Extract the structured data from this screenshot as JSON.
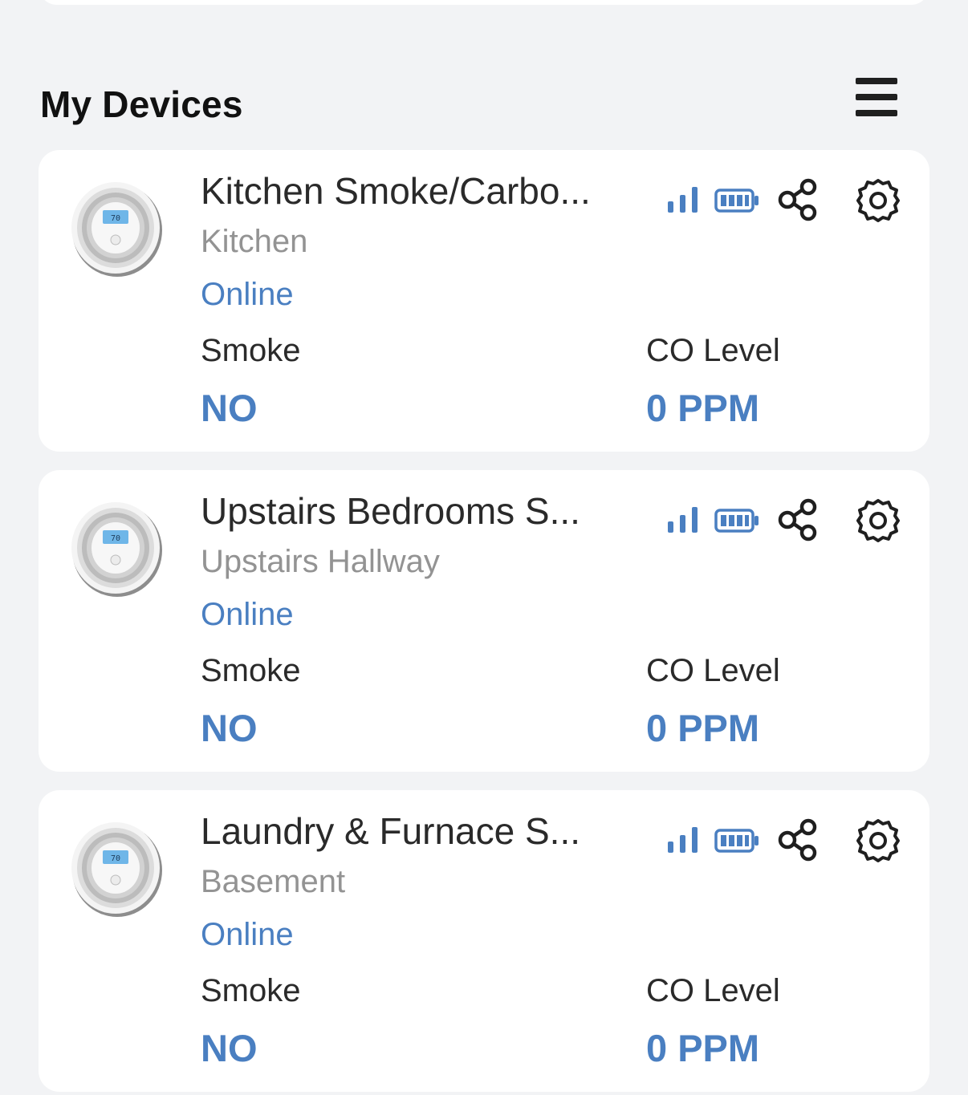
{
  "header": {
    "title": "My Devices",
    "menu_icon": "hamburger-menu-icon"
  },
  "colors": {
    "background": "#f2f3f5",
    "card": "#ffffff",
    "accent": "#4a7fc1",
    "secondary_text": "#939393",
    "primary_text": "#2a2a2a"
  },
  "devices": [
    {
      "name": "Kitchen Smoke/Carbo...",
      "room": "Kitchen",
      "status": "Online",
      "smoke_label": "Smoke",
      "smoke_value": "NO",
      "co_label": "CO Level",
      "co_value": "0 PPM",
      "display_reading": "70"
    },
    {
      "name": "Upstairs Bedrooms S...",
      "room": "Upstairs Hallway",
      "status": "Online",
      "smoke_label": "Smoke",
      "smoke_value": "NO",
      "co_label": "CO Level",
      "co_value": "0 PPM",
      "display_reading": "70"
    },
    {
      "name": "Laundry & Furnace S...",
      "room": "Basement",
      "status": "Online",
      "smoke_label": "Smoke",
      "smoke_value": "NO",
      "co_label": "CO Level",
      "co_value": "0 PPM",
      "display_reading": "70"
    }
  ],
  "icons": {
    "signal": "signal-strength-icon",
    "battery": "battery-icon",
    "share": "share-icon",
    "settings": "gear-icon"
  }
}
